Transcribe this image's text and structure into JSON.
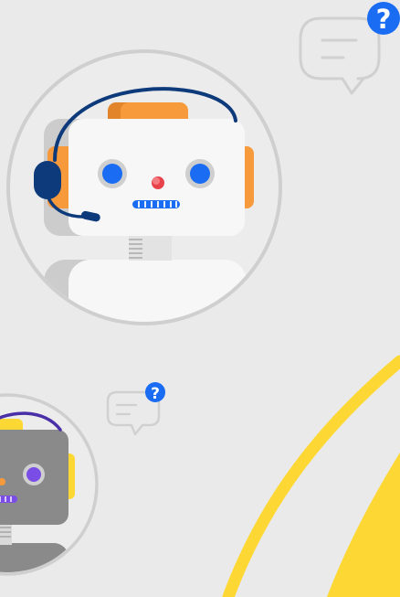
{
  "illustration": {
    "colors": {
      "background": "#eaeaea",
      "ring": "#cfcfcf",
      "robot_face": "#f7f7f7",
      "robot_shadow": "#cccccc",
      "robot_ear": "#f79a3b",
      "robot_eye": "#1a6cf2",
      "robot_nose": "#e8434b",
      "headset": "#0d3a7a",
      "help_badge": "#1a6cf2",
      "dark_robot_face": "#8a8a8a",
      "dark_robot_ear": "#fdd835",
      "dark_robot_eye": "#7a4ee6",
      "accent_arc": "#fdd835"
    },
    "icons": [
      "speech-bubble-icon",
      "help-question-icon",
      "robot-icon",
      "headset-icon"
    ],
    "help_badges": [
      {
        "symbol": "?"
      },
      {
        "symbol": "?"
      }
    ]
  }
}
